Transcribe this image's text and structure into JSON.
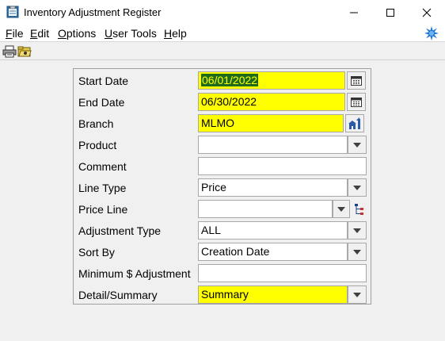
{
  "window": {
    "title": "Inventory Adjustment Register"
  },
  "menu": {
    "items": [
      {
        "label": "File",
        "underline": "F",
        "rest": "ile"
      },
      {
        "label": "Edit",
        "underline": "E",
        "rest": "dit"
      },
      {
        "label": "Options",
        "underline": "O",
        "rest": "ptions"
      },
      {
        "label": "User Tools",
        "underline": "U",
        "rest": "ser Tools"
      },
      {
        "label": "Help",
        "underline": "H",
        "rest": "elp"
      }
    ]
  },
  "toolbar": {
    "icons": [
      "printer-icon",
      "folder-icon"
    ]
  },
  "form": {
    "start_date": {
      "label": "Start Date",
      "value": "06/01/2022"
    },
    "end_date": {
      "label": "End Date",
      "value": "06/30/2022"
    },
    "branch": {
      "label": "Branch",
      "value": "MLMO"
    },
    "product": {
      "label": "Product",
      "value": ""
    },
    "comment": {
      "label": "Comment",
      "value": ""
    },
    "line_type": {
      "label": "Line Type",
      "value": "Price"
    },
    "price_line": {
      "label": "Price Line",
      "value": ""
    },
    "adjustment_type": {
      "label": "Adjustment Type",
      "value": "ALL"
    },
    "sort_by": {
      "label": "Sort By",
      "value": "Creation Date"
    },
    "min_adjustment": {
      "label": "Minimum $ Adjustment",
      "value": ""
    },
    "detail_summary": {
      "label": "Detail/Summary",
      "value": "Summary"
    }
  },
  "colors": {
    "required_field": "#ffff00",
    "selection_bg": "#1e6b1e",
    "selection_text": "#ffff00",
    "accent_star": "#1e78d2"
  }
}
